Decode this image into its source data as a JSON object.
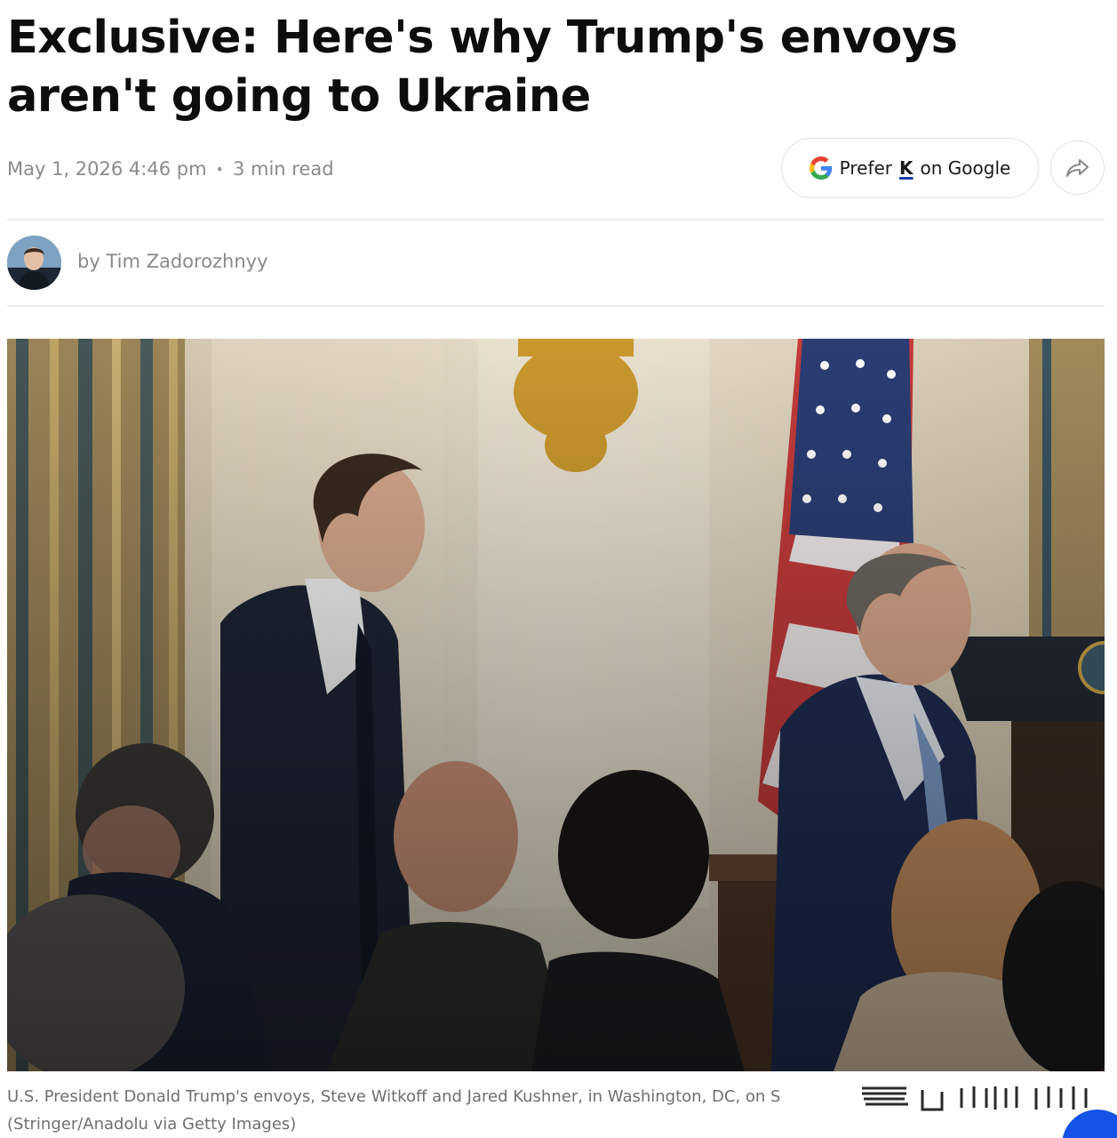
{
  "article": {
    "headline": "Exclusive: Here's why Trump's envoys aren't going to Ukraine",
    "date": "May 1, 2026 4:46 pm",
    "separator": "•",
    "read_time": "3 min read",
    "byline": "by Tim Zadorozhnyy",
    "caption_line1": "U.S. President Donald Trump's envoys, Steve Witkoff and Jared Kushner, in Washington, DC, on S",
    "caption_line2": "(Stringer/Anadolu via Getty Images)"
  },
  "actions": {
    "prefer_prefix": "Prefer",
    "prefer_brand": "K",
    "prefer_suffix": "on Google",
    "share_icon": "share-arrow-icon",
    "google_icon": "google-g-icon"
  },
  "colors": {
    "brand_underline": "#1a3ca8",
    "corner_accent": "#1453e6",
    "muted_text": "#8a8a8a"
  }
}
